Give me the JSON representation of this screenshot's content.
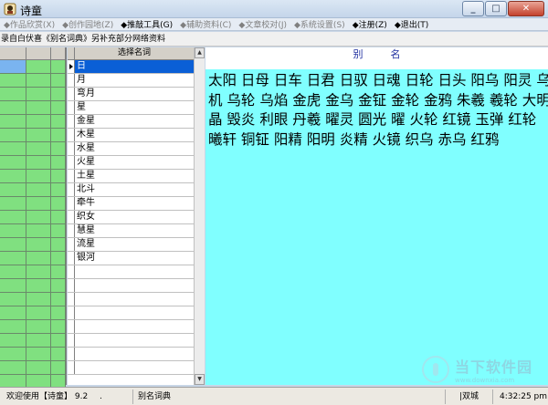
{
  "window": {
    "title": "诗童"
  },
  "menu": [
    {
      "label": "◆作品欣赏(X)",
      "enabled": false
    },
    {
      "label": "◆创作园地(Z)",
      "enabled": false
    },
    {
      "label": "◆推敲工具(G)",
      "enabled": true
    },
    {
      "label": "◆辅助资料(C)",
      "enabled": false
    },
    {
      "label": "◆文章校对(J)",
      "enabled": false
    },
    {
      "label": "◆系统设置(S)",
      "enabled": false
    },
    {
      "label": "◆注册(Z)",
      "enabled": true
    },
    {
      "label": "◆退出(T)",
      "enabled": true
    }
  ],
  "info_text": "录自白伏喜《别名词典》另补充部分网络资料",
  "name_list": {
    "header": "选择名词",
    "items": [
      "日",
      "月",
      "弯月",
      "星",
      "金星",
      "木星",
      "水星",
      "火星",
      "土星",
      "北斗",
      "牵牛",
      "织女",
      "慧星",
      "流星",
      "银河"
    ],
    "selected": "日"
  },
  "results": {
    "header": "别名",
    "text": "太阳 日母 日车 日君 日驭 日魂 日轮 日头 阳乌 阳灵 乌机 乌轮 乌焰 金虎 金乌 金钲 金轮 金鸦 朱羲 羲轮 大明 晶 毁炎 利眼 丹羲 曜灵 圆光 曜 火轮 红镜 玉弹 红轮 曦轩 铜钲 阳精 阳明 炎精 火镜 织乌 赤乌 红鸦"
  },
  "status": {
    "welcome": "欢迎使用【诗童】 9.2",
    "dot": ".",
    "section": "别名词典",
    "mode": "|双城",
    "time": "4:32:25 pm"
  },
  "watermark": {
    "cn": "当下软件园",
    "en": "www.downxia.com"
  },
  "colors": {
    "list_green": "#80e080",
    "result_cyan": "#80ffff",
    "selection_blue": "#0a5fd6"
  }
}
